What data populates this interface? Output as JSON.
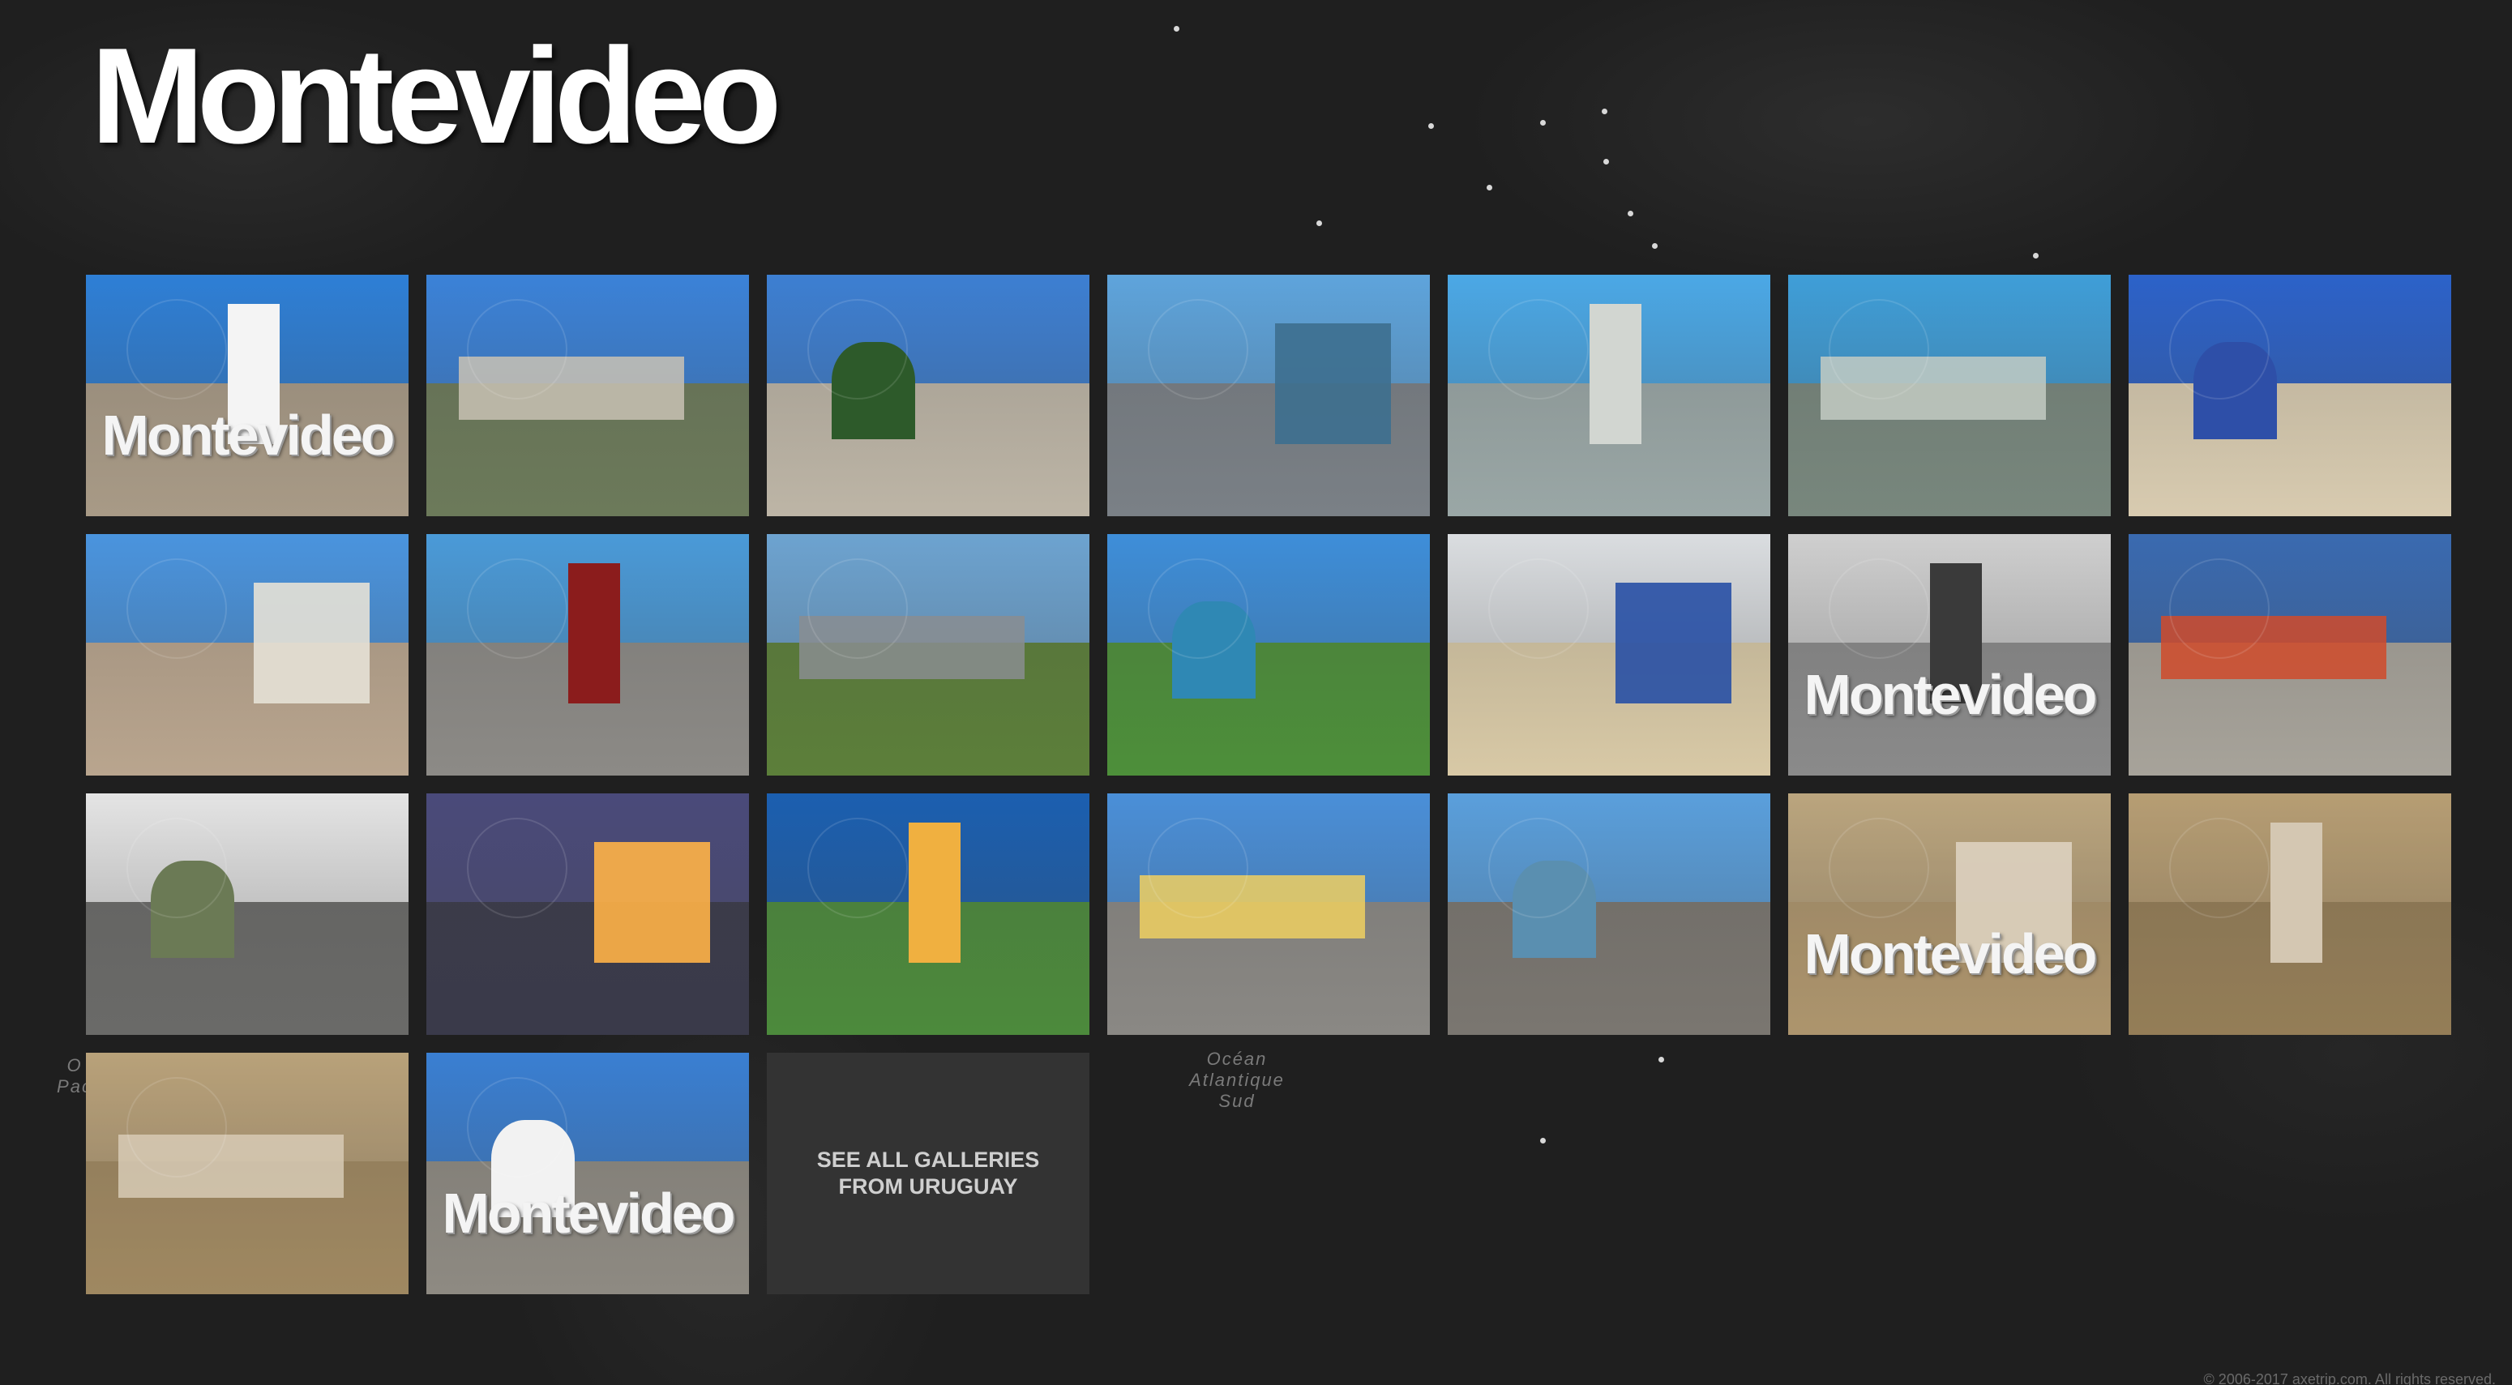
{
  "page": {
    "title": "Montevideo",
    "background": "#1f1f1f"
  },
  "map_labels": [
    {
      "text": "Océan\nAtlantique\nSud"
    },
    {
      "text": "O\nPac"
    }
  ],
  "gallery": {
    "tiles": [
      {
        "kind": "photo",
        "subject": "Montevideo sign on beach",
        "sky": "#2e7fd6",
        "ground": "#a89a86",
        "feature": "#f4f4f4",
        "text": "Montevideo"
      },
      {
        "kind": "photo",
        "subject": "Plaza Independencia with Palacio Salvo",
        "sky": "#3b82d8",
        "ground": "#6c7a5a",
        "feature": "#c9c2b4"
      },
      {
        "kind": "photo",
        "subject": "Man jumping in front of Palacio Salvo",
        "sky": "#3d7fd2",
        "ground": "#bdb5a6",
        "feature": "#2d5a2a"
      },
      {
        "kind": "photo",
        "subject": "Aerial view of the port",
        "sky": "#5ea4dc",
        "ground": "#7a8086",
        "feature": "#3d6f8f"
      },
      {
        "kind": "photo",
        "subject": "Aerial city view with coast",
        "sky": "#4ba8e6",
        "ground": "#9aa7a6",
        "feature": "#d2d6d1"
      },
      {
        "kind": "photo",
        "subject": "Palacio Salvo close-up",
        "sky": "#3f9ed8",
        "ground": "#78877d",
        "feature": "#c3cbc3"
      },
      {
        "kind": "photo",
        "subject": "Uruguay flag by a tower",
        "sky": "#2c62c9",
        "ground": "#d8cbb0",
        "feature": "#2e4fa8"
      },
      {
        "kind": "photo",
        "subject": "Old town rooftops",
        "sky": "#4a94de",
        "ground": "#b9a58e",
        "feature": "#e6e1d6"
      },
      {
        "kind": "photo",
        "subject": "Newsstand kiosk on street",
        "sky": "#4a9ad8",
        "ground": "#8c8a86",
        "feature": "#8b1c1c"
      },
      {
        "kind": "photo",
        "subject": "Boulevard with palm trees",
        "sky": "#6da3d0",
        "ground": "#5c7f3a",
        "feature": "#8a8d90"
      },
      {
        "kind": "photo",
        "subject": "Rambla along the coast",
        "sky": "#3e8ed9",
        "ground": "#4d8f3a",
        "feature": "#2f88b4"
      },
      {
        "kind": "photo",
        "subject": "Lifeguard tower and flag on beach",
        "sky": "#dadde0",
        "ground": "#d8c9a6",
        "feature": "#2850a5"
      },
      {
        "kind": "photo",
        "subject": "AxeTrip logo watermark",
        "sky": "#cfcfcf",
        "ground": "#8a8a8a",
        "feature": "#3a3a3a",
        "text": "Montevideo"
      },
      {
        "kind": "photo",
        "subject": "Graffiti wall with man reading",
        "sky": "#3a6ab0",
        "ground": "#a7a39a",
        "feature": "#d04a2a"
      },
      {
        "kind": "photo",
        "subject": "Colorful street facades",
        "sky": "#e4e4e4",
        "ground": "#6a6a68",
        "feature": "#6b7a55"
      },
      {
        "kind": "photo",
        "subject": "Sunset over the sea",
        "sky": "#4a4a7a",
        "ground": "#3a3a4a",
        "feature": "#ffb347"
      },
      {
        "kind": "photo",
        "subject": "Rambla at night with city lights",
        "sky": "#1b5fb0",
        "ground": "#4c8a3c",
        "feature": "#f0b040"
      },
      {
        "kind": "photo",
        "subject": "Taxi in front of buildings",
        "sky": "#4a8fd8",
        "ground": "#8a8884",
        "feature": "#f0d060"
      },
      {
        "kind": "photo",
        "subject": "Modern glass building and theater",
        "sky": "#5a9fdc",
        "ground": "#7a7670",
        "feature": "#5a8fb0"
      },
      {
        "kind": "photo",
        "subject": "Montevideo sign sepia",
        "sky": "#c9b68f",
        "ground": "#b8a27a",
        "feature": "#f3ecdf",
        "text": "Montevideo",
        "sepia": true
      },
      {
        "kind": "photo",
        "subject": "Street vendor sepia",
        "sky": "#c4ad82",
        "ground": "#9a8660",
        "feature": "#e8e0cf",
        "sepia": true
      },
      {
        "kind": "photo",
        "subject": "Old car on street sepia",
        "sky": "#c7b28a",
        "ground": "#a8936c",
        "feature": "#ece4d2",
        "sepia": true
      },
      {
        "kind": "photo",
        "subject": "Montevideo sign by the bay",
        "sky": "#3a7fd2",
        "ground": "#8e8a82",
        "feature": "#f2f2f2",
        "text": "Montevideo"
      }
    ],
    "see_all": {
      "label": "SEE ALL GALLERIES FROM URUGUAY",
      "background": "#333333"
    }
  },
  "footer": {
    "copyright": "© 2006-2017 axetrip.com. All rights reserved."
  }
}
